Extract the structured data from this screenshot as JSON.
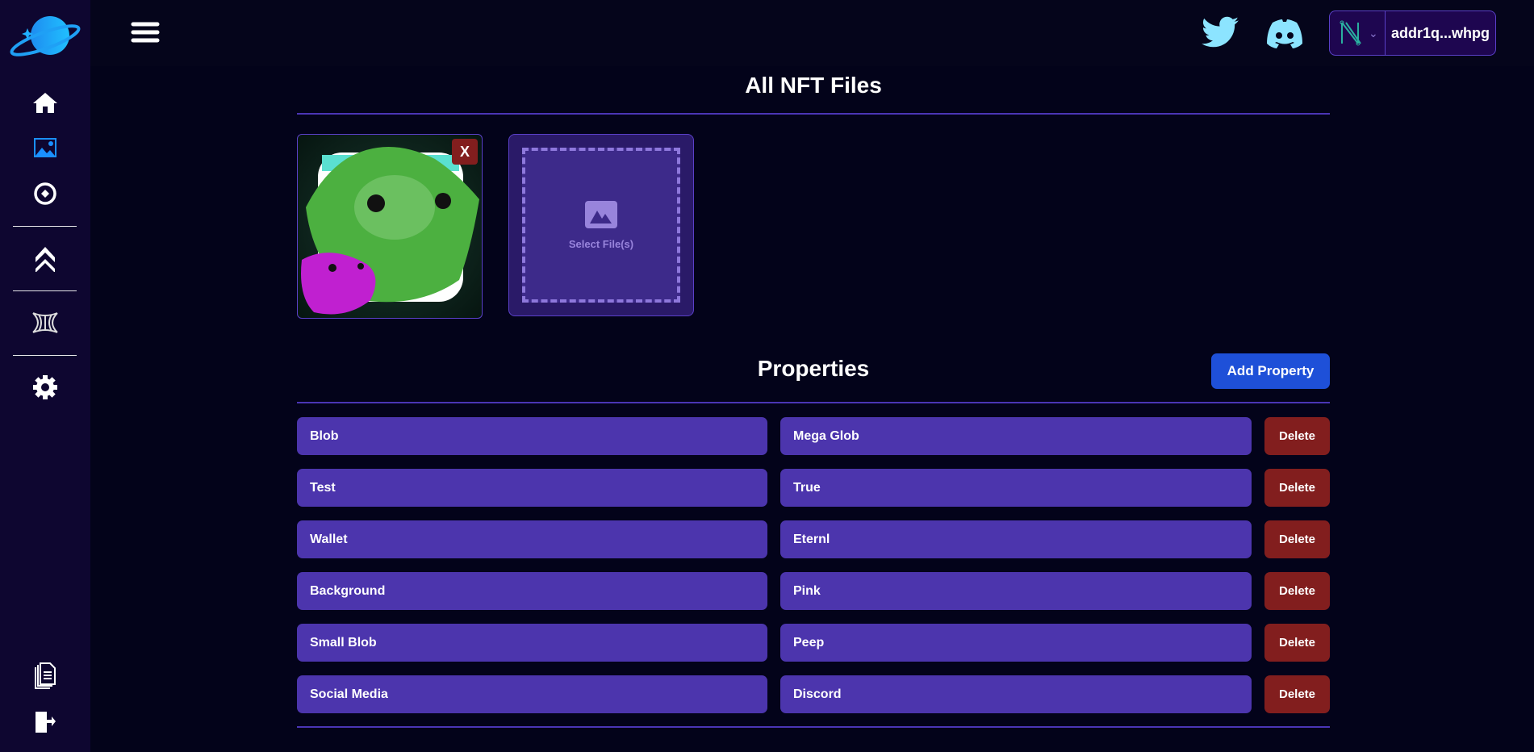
{
  "sidebar": {
    "items": [
      {
        "icon": "home-icon"
      },
      {
        "icon": "image-icon",
        "active": true
      },
      {
        "icon": "compass-icon"
      },
      {
        "icon": "double-chevron-up-icon"
      },
      {
        "icon": "wormhole-icon"
      },
      {
        "icon": "gear-icon"
      },
      {
        "icon": "documents-icon"
      },
      {
        "icon": "logout-icon"
      }
    ]
  },
  "header": {
    "wallet_address": "addr1q...whpg"
  },
  "files": {
    "title": "All NFT Files",
    "remove_label": "X",
    "select_label": "Select File(s)"
  },
  "properties": {
    "title": "Properties",
    "add_label": "Add Property",
    "delete_label": "Delete",
    "rows": [
      {
        "key": "Blob",
        "value": "Mega Glob"
      },
      {
        "key": "Test",
        "value": "True"
      },
      {
        "key": "Wallet",
        "value": "Eternl"
      },
      {
        "key": "Background",
        "value": "Pink"
      },
      {
        "key": "Small Blob",
        "value": "Peep"
      },
      {
        "key": "Social Media",
        "value": "Discord"
      }
    ]
  },
  "colors": {
    "accent": "#4c35ad",
    "delete": "#821e1e",
    "primary": "#1e50d8",
    "sidebar": "#0e0630",
    "background": "#03031a"
  }
}
